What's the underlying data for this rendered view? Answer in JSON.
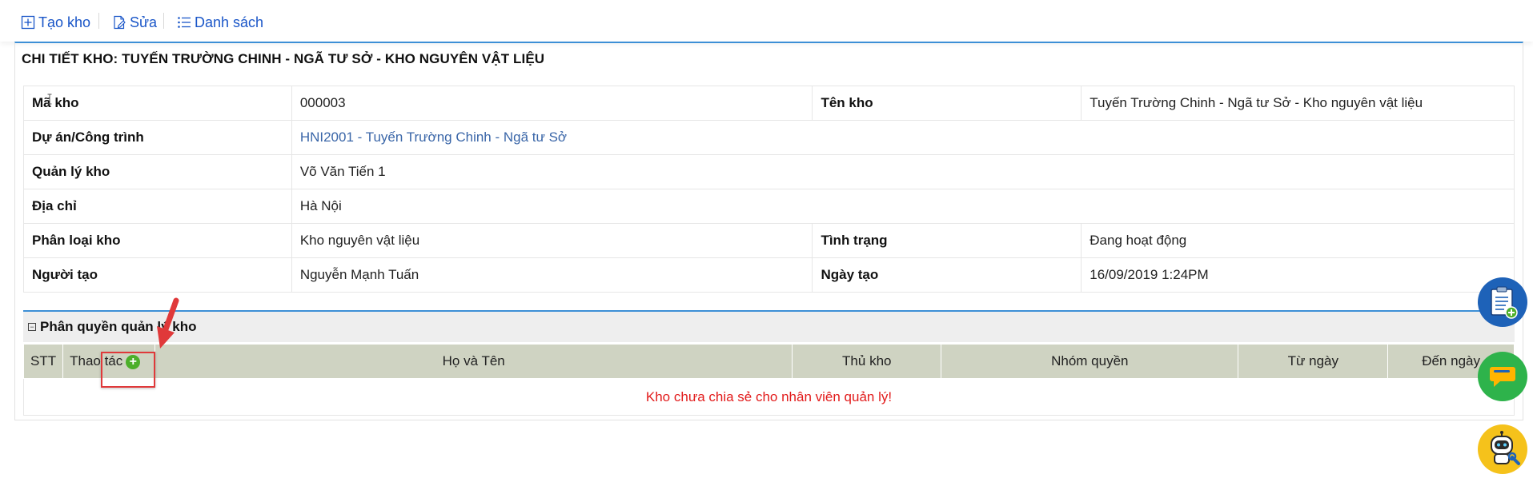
{
  "toolbar": {
    "create": "Tạo kho",
    "edit": "Sửa",
    "list": "Danh sách"
  },
  "title": "CHI TIẾT KHO: TUYẾN TRƯỜNG CHINH - NGÃ TƯ SỞ - KHO NGUYÊN VẬT LIỆU",
  "detail": {
    "code_label": "Mã kho",
    "code_value": "000003",
    "name_label": "Tên kho",
    "name_value": "Tuyến Trường Chinh - Ngã tư Sở - Kho nguyên vật liệu",
    "project_label": "Dự án/Công trình",
    "project_value": "HNI2001 - Tuyến Trường Chinh - Ngã tư Sở",
    "manager_label": "Quản lý kho",
    "manager_value": "Võ Văn Tiến 1",
    "address_label": "Địa chỉ",
    "address_value": "Hà Nội",
    "type_label": "Phân loại kho",
    "type_value": "Kho nguyên vật liệu",
    "status_label": "Tình trạng",
    "status_value": "Đang hoạt động",
    "creator_label": "Người tạo",
    "creator_value": "Nguyễn Mạnh Tuấn",
    "created_label": "Ngày tạo",
    "created_value": "16/09/2019 1:24PM"
  },
  "permissions": {
    "toggle": "−",
    "title": "Phân quyền quản lý kho",
    "columns": {
      "stt": "STT",
      "action": "Thao tác",
      "name": "Họ và Tên",
      "keeper": "Thủ kho",
      "group": "Nhóm quyền",
      "from": "Từ ngày",
      "to": "Đến ngày"
    },
    "empty_message": "Kho chưa chia sẻ cho nhân viên quản lý!"
  },
  "colors": {
    "link": "#1a56c8",
    "accent": "#3d8fd6",
    "header_bg": "#cfd3c2",
    "empty_text": "#e21b1b",
    "add_icon": "#4caf2a",
    "highlight": "#e0393a"
  },
  "icons": {
    "create": "plus-square-icon",
    "edit": "edit-document-icon",
    "list": "list-icon",
    "add": "plus-circle-icon",
    "float1": "clipboard-add-icon",
    "float2": "chat-icon",
    "float3": "robot-support-icon"
  }
}
